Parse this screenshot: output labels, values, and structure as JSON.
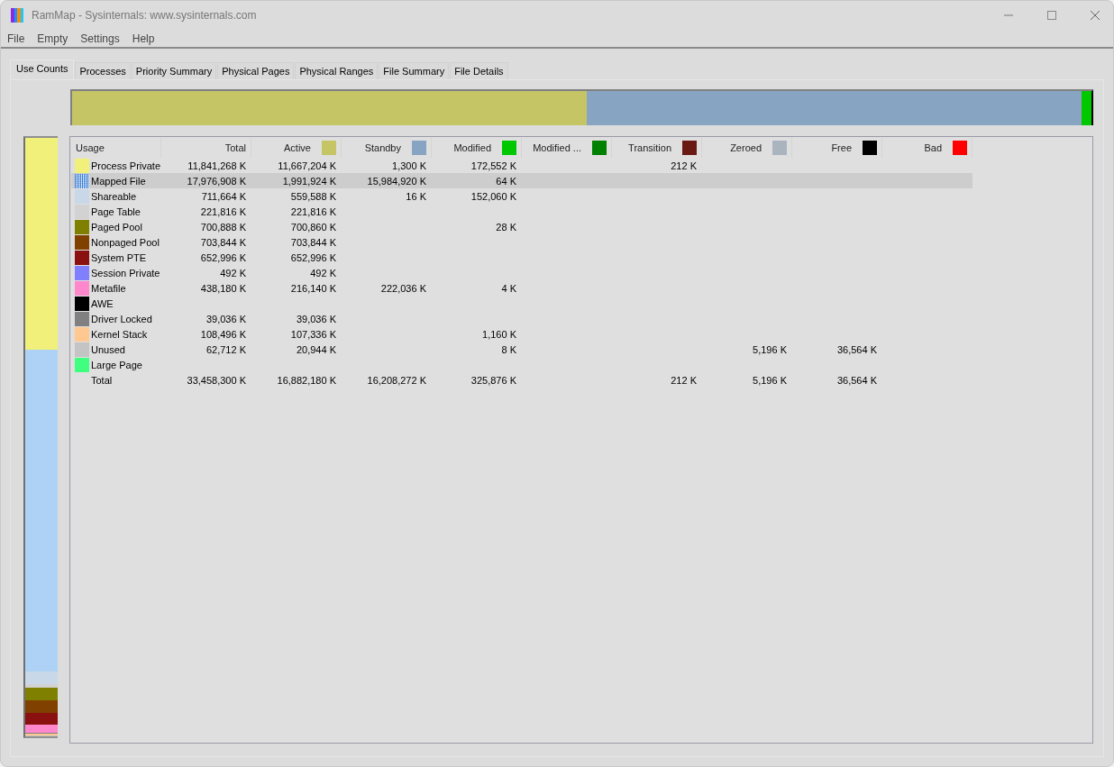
{
  "window": {
    "title": "RamMap - Sysinternals: www.sysinternals.com"
  },
  "menu": [
    "File",
    "Empty",
    "Settings",
    "Help"
  ],
  "tabs": [
    {
      "label": "Use Counts",
      "selected": true
    },
    {
      "label": "Processes",
      "selected": false
    },
    {
      "label": "Priority Summary",
      "selected": false
    },
    {
      "label": "Physical Pages",
      "selected": false
    },
    {
      "label": "Physical Ranges",
      "selected": false
    },
    {
      "label": "File Summary",
      "selected": false
    },
    {
      "label": "File Details",
      "selected": false
    }
  ],
  "table": {
    "columns": [
      {
        "label": "Usage"
      },
      {
        "label": "Total"
      },
      {
        "label": "Active",
        "color": "#c5c566"
      },
      {
        "label": "Standby",
        "color": "#87a4c3"
      },
      {
        "label": "Modified",
        "color": "#00c800"
      },
      {
        "label": "Modified ...",
        "color": "#008000"
      },
      {
        "label": "Transition",
        "color": "#6a1a12"
      },
      {
        "label": "Zeroed",
        "color": "#aab4bf"
      },
      {
        "label": "Free",
        "color": "#000000"
      },
      {
        "label": "Bad",
        "color": "#ff0000"
      }
    ],
    "rows": [
      {
        "kind": "item",
        "color": "#f0f07a",
        "selected": false,
        "cells": [
          "Process Private",
          "11,841,268 K",
          "11,667,204 K",
          "1,300 K",
          "172,552 K",
          "",
          "212 K"
        ]
      },
      {
        "kind": "item",
        "color": "#aed2f6",
        "selected": true,
        "cells": [
          "Mapped File",
          "17,976,908 K",
          "1,991,924 K",
          "15,984,920 K",
          "64 K"
        ]
      },
      {
        "kind": "item",
        "color": "#c8d8e8",
        "selected": false,
        "cells": [
          "Shareable",
          "711,664 K",
          "559,588 K",
          "16 K",
          "152,060 K"
        ]
      },
      {
        "kind": "item",
        "color": "#d2d2d2",
        "selected": false,
        "cells": [
          "Page Table",
          "221,816 K",
          "221,816 K"
        ]
      },
      {
        "kind": "item",
        "color": "#808000",
        "selected": false,
        "cells": [
          "Paged Pool",
          "700,888 K",
          "700,860 K",
          "",
          "28 K"
        ]
      },
      {
        "kind": "item",
        "color": "#804000",
        "selected": false,
        "cells": [
          "Nonpaged Pool",
          "703,844 K",
          "703,844 K"
        ]
      },
      {
        "kind": "item",
        "color": "#8b1010",
        "selected": false,
        "cells": [
          "System PTE",
          "652,996 K",
          "652,996 K"
        ]
      },
      {
        "kind": "item",
        "color": "#8080ff",
        "selected": false,
        "cells": [
          "Session Private",
          "492 K",
          "492 K"
        ]
      },
      {
        "kind": "item",
        "color": "#ff88cc",
        "selected": false,
        "cells": [
          "Metafile",
          "438,180 K",
          "216,140 K",
          "222,036 K",
          "4 K"
        ]
      },
      {
        "kind": "item",
        "color": "#000000",
        "selected": false,
        "cells": [
          "AWE"
        ]
      },
      {
        "kind": "item",
        "color": "#808080",
        "selected": false,
        "cells": [
          "Driver Locked",
          "39,036 K",
          "39,036 K"
        ]
      },
      {
        "kind": "item",
        "color": "#ffc890",
        "selected": false,
        "cells": [
          "Kernel Stack",
          "108,496 K",
          "107,336 K",
          "",
          "1,160 K"
        ]
      },
      {
        "kind": "item",
        "color": "#c4c4c4",
        "selected": false,
        "cells": [
          "Unused",
          "62,712 K",
          "20,944 K",
          "",
          "8 K",
          "",
          "",
          "5,196 K",
          "36,564 K"
        ]
      },
      {
        "kind": "item",
        "color": "#40ff80",
        "selected": false,
        "cells": [
          "Large Page"
        ]
      },
      {
        "kind": "total",
        "selected": false,
        "cells": [
          "Total",
          "33,458,300 K",
          "16,882,180 K",
          "16,208,272 K",
          "325,876 K",
          "",
          "212 K",
          "5,196 K",
          "36,564 K"
        ]
      }
    ]
  }
}
